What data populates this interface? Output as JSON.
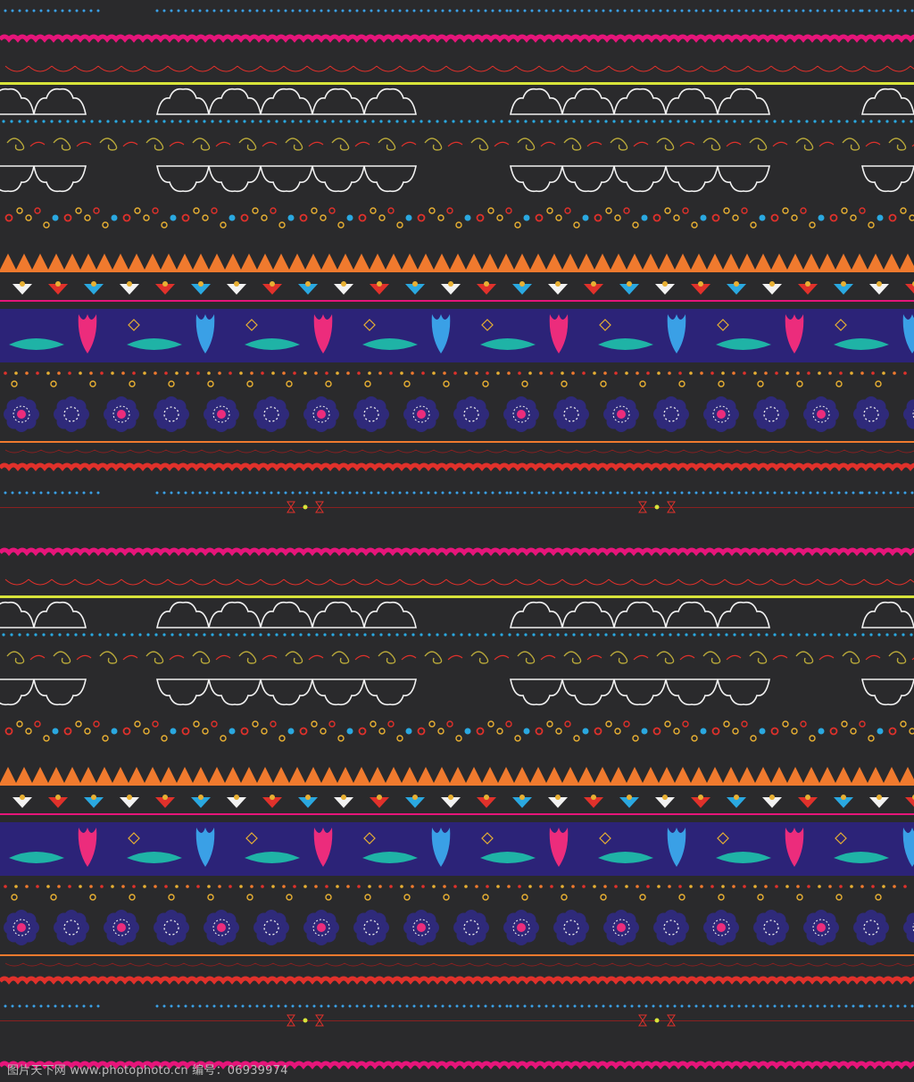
{
  "pattern": {
    "motif_period": "two repeating tiles stacked vertically",
    "colors": {
      "background": "#2a2a2c",
      "magenta": "#e6157a",
      "yellow": "#d8e43a",
      "white": "#f2f2f2",
      "cyan": "#2aa8e0",
      "olive": "#b9a93a",
      "red": "#e0312b",
      "orange": "#f07a2e",
      "gold": "#e8b033",
      "indigo_band": "#2c2378",
      "teal": "#1fb3a6",
      "blue": "#3aa0e6",
      "pink": "#ec2c7c",
      "navy_flower": "#2f2a7a",
      "dark_red": "#8a2020"
    },
    "rows": [
      "magenta-scallop",
      "red-thin-arcs",
      "yellow-line",
      "white-cloud-outline",
      "cyan-dot-line",
      "olive-swirls",
      "white-cloud-outline-inverted",
      "dotted-circles",
      "orange-triangles",
      "lotus-fans",
      "indigo-tulip-band",
      "dot-line-multicolor",
      "navy-flowers",
      "orange-line",
      "red-scallop",
      "blue-dot-segments",
      "hourglass-accents"
    ]
  },
  "watermark": {
    "text": "图片天下网 www.photophoto.cn 编号：06939974"
  }
}
